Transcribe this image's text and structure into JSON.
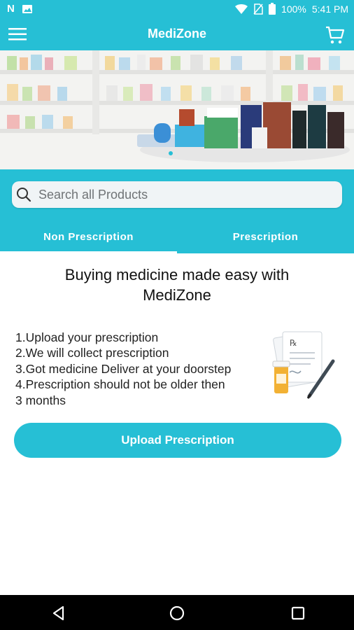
{
  "status_bar": {
    "battery": "100%",
    "time": "5:41 PM"
  },
  "app_bar": {
    "title": "MediZone"
  },
  "search": {
    "placeholder": "Search all Products"
  },
  "tabs": [
    {
      "label": "Non Prescription",
      "active": true
    },
    {
      "label": "Prescription",
      "active": false
    }
  ],
  "content": {
    "title_line1": "Buying medicine made easy with",
    "title_line2": "MediZone",
    "steps": [
      "1.Upload your prescription",
      "2.We will collect prescription",
      "3.Got medicine Deliver at your doorstep",
      "4.Prescription should not be older then",
      "3 months"
    ],
    "upload_label": "Upload Prescription"
  },
  "colors": {
    "primary": "#26bfd5",
    "navbar": "#000000",
    "text": "#111111"
  },
  "icons": [
    "notification-n-icon",
    "image-icon",
    "wifi-icon",
    "no-sim-icon",
    "battery-icon",
    "menu-icon",
    "cart-icon",
    "search-icon",
    "prescription-icon",
    "back-icon",
    "home-icon",
    "recents-icon"
  ]
}
